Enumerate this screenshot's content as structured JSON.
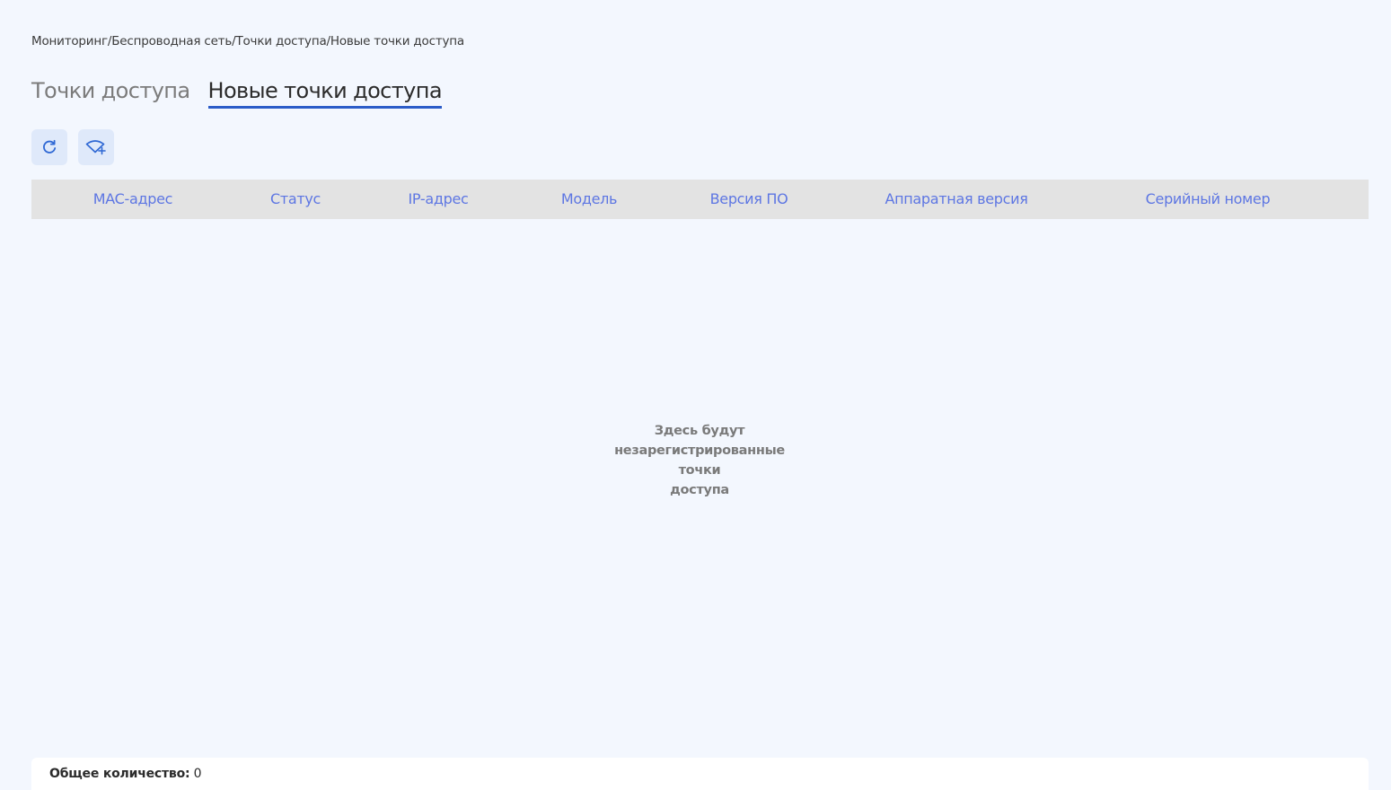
{
  "breadcrumb": "Мониторинг/Беспроводная сеть/Точки доступа/Новые точки доступа",
  "tabs": [
    {
      "label": "Точки доступа",
      "active": false
    },
    {
      "label": "Новые точки доступа",
      "active": true
    }
  ],
  "toolbar": {
    "refresh_icon": "refresh-icon",
    "add_ap_icon": "add-access-point-icon"
  },
  "table": {
    "columns": [
      "MAC-адрес",
      "Статус",
      "IP-адрес",
      "Модель",
      "Версия ПО",
      "Аппаратная версия",
      "Серийный номер"
    ],
    "rows": [],
    "empty_line1": "Здесь будут",
    "empty_line2": "незарегистрированные точки",
    "empty_line3": "доступа"
  },
  "footer": {
    "total_label": "Общее количество:",
    "total_value": "0"
  },
  "colors": {
    "background": "#f3f7fe",
    "accent": "#2b5cc8",
    "header_text": "#5d76e3",
    "header_bg": "#e3e3e3",
    "button_bg": "#dfe9fa"
  }
}
